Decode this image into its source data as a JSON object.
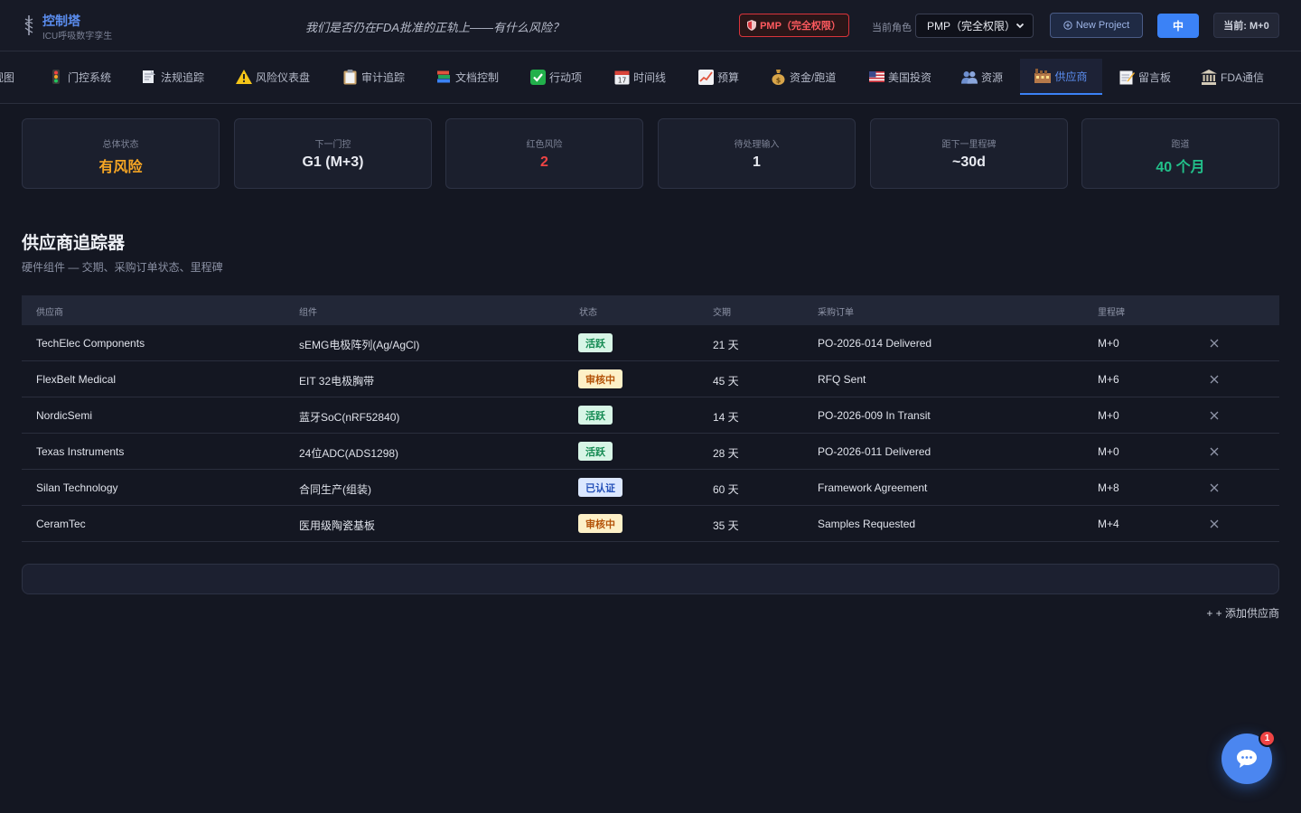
{
  "header": {
    "title": "控制塔",
    "subtitle": "ICU呼吸数字孪生",
    "tagline": "我们是否仍在FDA批准的正轨上——有什么风险？",
    "role_badge": "PMP（完全权限）",
    "role_label": "当前角色",
    "role_select_value": "PMP（完全权限）",
    "new_project_label": "New Project",
    "lang_button": "中",
    "current_month": "当前: M+0"
  },
  "tabs": [
    {
      "label": "视图",
      "icon": "view-icon"
    },
    {
      "label": "门控系统",
      "icon": "traffic-light-icon"
    },
    {
      "label": "法规追踪",
      "icon": "document-icon"
    },
    {
      "label": "风险仪表盘",
      "icon": "warning-icon"
    },
    {
      "label": "审计追踪",
      "icon": "clipboard-icon"
    },
    {
      "label": "文档控制",
      "icon": "books-icon"
    },
    {
      "label": "行动项",
      "icon": "checkmark-icon"
    },
    {
      "label": "时间线",
      "icon": "calendar-icon"
    },
    {
      "label": "预算",
      "icon": "chart-icon"
    },
    {
      "label": "资金/跑道",
      "icon": "money-bag-icon"
    },
    {
      "label": "美国投资",
      "icon": "us-flag-icon"
    },
    {
      "label": "资源",
      "icon": "people-icon"
    },
    {
      "label": "供应商",
      "icon": "factory-icon"
    },
    {
      "label": "留言板",
      "icon": "memo-icon"
    },
    {
      "label": "FDA通信",
      "icon": "building-icon"
    }
  ],
  "active_tab": "供应商",
  "stats": [
    {
      "label": "总体状态",
      "value": "有风险",
      "color": "#f5a524"
    },
    {
      "label": "下一门控",
      "value": "G1 (M+3)",
      "color": "#e8eaf1"
    },
    {
      "label": "红色风险",
      "value": "2",
      "color": "#ef4444"
    },
    {
      "label": "待处理输入",
      "value": "1",
      "color": "#e8eaf1"
    },
    {
      "label": "距下一里程碑",
      "value": "~30d",
      "color": "#e8eaf1"
    },
    {
      "label": "跑道",
      "value": "40 个月",
      "color": "#22c08a"
    }
  ],
  "section": {
    "title": "供应商追踪器",
    "subtitle": "硬件组件 — 交期、采购订单状态、里程碑"
  },
  "table": {
    "headers": [
      "供应商",
      "组件",
      "状态",
      "交期",
      "采购订单",
      "里程碑"
    ],
    "rows": [
      {
        "supplier": "TechElec Components",
        "component": "sEMG电极阵列(Ag/AgCl)",
        "status": "活跃",
        "status_type": "active",
        "lead_time": "21 天",
        "po": "PO-2026-014 Delivered",
        "milestone": "M+0"
      },
      {
        "supplier": "FlexBelt Medical",
        "component": "EIT 32电极胸带",
        "status": "审核中",
        "status_type": "review",
        "lead_time": "45 天",
        "po": "RFQ Sent",
        "milestone": "M+6"
      },
      {
        "supplier": "NordicSemi",
        "component": "蓝牙SoC(nRF52840)",
        "status": "活跃",
        "status_type": "active",
        "lead_time": "14 天",
        "po": "PO-2026-009 In Transit",
        "milestone": "M+0"
      },
      {
        "supplier": "Texas Instruments",
        "component": "24位ADC(ADS1298)",
        "status": "活跃",
        "status_type": "active",
        "lead_time": "28 天",
        "po": "PO-2026-011 Delivered",
        "milestone": "M+0"
      },
      {
        "supplier": "Silan Technology",
        "component": "合同生产(组装)",
        "status": "已认证",
        "status_type": "certified",
        "lead_time": "60 天",
        "po": "Framework Agreement",
        "milestone": "M+8"
      },
      {
        "supplier": "CeramTec",
        "component": "医用级陶瓷基板",
        "status": "审核中",
        "status_type": "review",
        "lead_time": "35 天",
        "po": "Samples Requested",
        "milestone": "M+4"
      }
    ]
  },
  "status_colors": {
    "active": {
      "bg": "#d7f5e6",
      "fg": "#138a52"
    },
    "review": {
      "bg": "#fdf0c7",
      "fg": "#b45309"
    },
    "certified": {
      "bg": "#dbe7ff",
      "fg": "#2450b8"
    }
  },
  "add_supplier_label": "+ 添加供应商",
  "chat": {
    "unread": "1"
  }
}
